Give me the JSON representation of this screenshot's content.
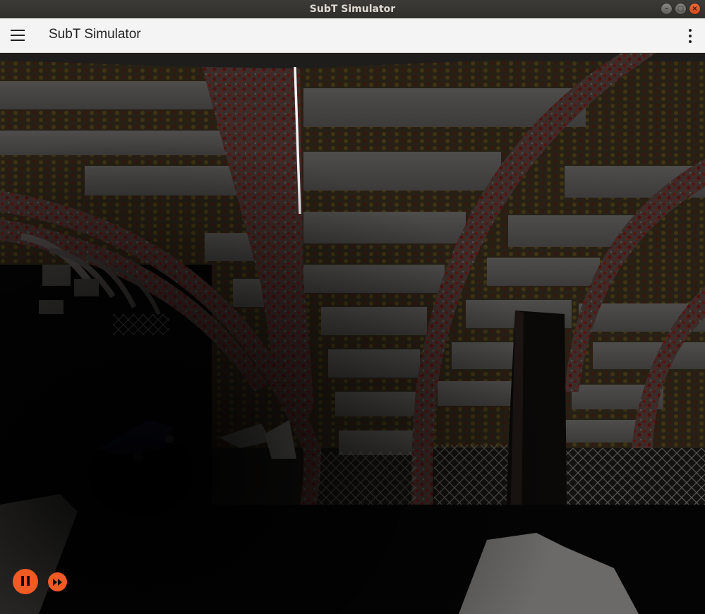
{
  "window": {
    "title": "SubT Simulator"
  },
  "app_bar": {
    "title": "SubT Simulator"
  },
  "icons": {
    "menu": "hamburger-menu-icon",
    "more": "more-vertical-icon",
    "pause": "pause-icon",
    "fast_forward": "fast-forward-icon"
  },
  "colors": {
    "accent": "#f05a23",
    "app_bar_bg": "#f4f4f4",
    "title_bar_bg": "#3c3b37"
  }
}
